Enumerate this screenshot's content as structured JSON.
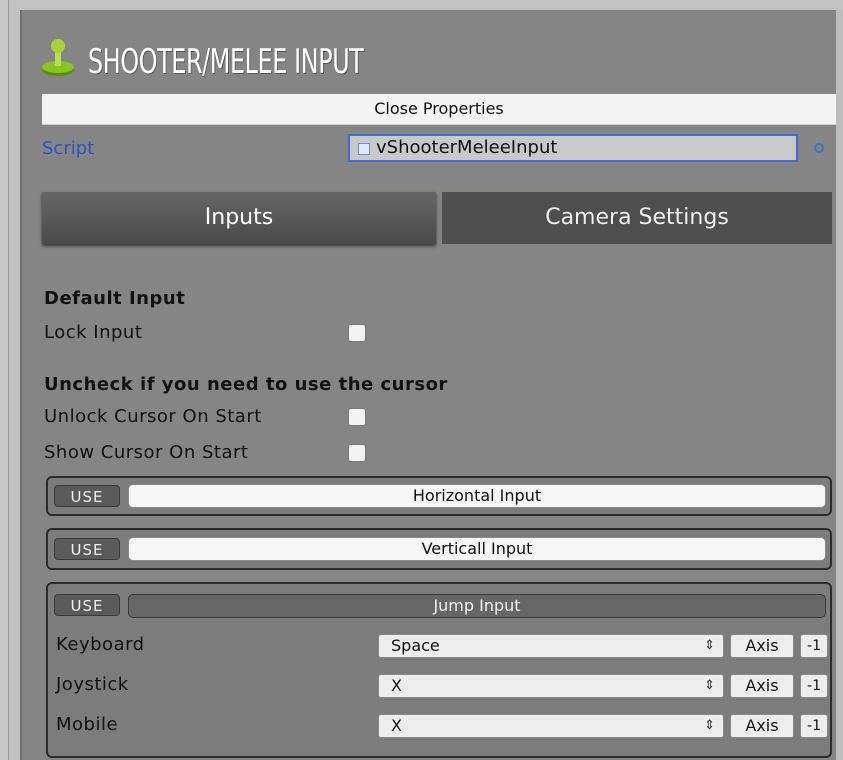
{
  "header": {
    "title": "SHOOTER/MELEE INPUT",
    "logo_icon": "joystick-icon"
  },
  "close_properties_label": "Close Properties",
  "script": {
    "label": "Script",
    "value": "vShooterMeleeInput",
    "file_icon": "script-file-icon",
    "picker_icon": "object-picker-icon"
  },
  "tabs": [
    {
      "label": "Inputs",
      "active": true
    },
    {
      "label": "Camera Settings",
      "active": false
    }
  ],
  "default_input": {
    "title": "Default Input",
    "lock_input": {
      "label": "Lock Input",
      "checked": false
    }
  },
  "cursor": {
    "title": "Uncheck if you need to use the cursor",
    "unlock_on_start": {
      "label": "Unlock Cursor On Start",
      "checked": false
    },
    "show_on_start": {
      "label": "Show Cursor On Start",
      "checked": false
    }
  },
  "inputs": [
    {
      "use": "USE",
      "name": "Horizontal Input"
    },
    {
      "use": "USE",
      "name": "Verticall Input"
    },
    {
      "use": "USE",
      "name": "Jump Input",
      "rows": [
        {
          "label": "Keyboard",
          "value": "Space",
          "axis": "Axis",
          "neg": "-1"
        },
        {
          "label": "Joystick",
          "value": "X",
          "axis": "Axis",
          "neg": "-1"
        },
        {
          "label": "Mobile",
          "value": "X",
          "axis": "Axis",
          "neg": "-1"
        }
      ]
    }
  ],
  "colors": {
    "panel": "#858585",
    "script_blue": "#2b56c7",
    "logo_green": "#7fb81c"
  }
}
